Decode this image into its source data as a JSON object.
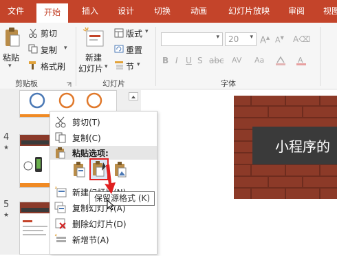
{
  "tabs": [
    {
      "label": "文件"
    },
    {
      "label": "开始"
    },
    {
      "label": "插入"
    },
    {
      "label": "设计"
    },
    {
      "label": "切换"
    },
    {
      "label": "动画"
    },
    {
      "label": "幻灯片放映"
    },
    {
      "label": "审阅"
    },
    {
      "label": "视图"
    }
  ],
  "ribbon": {
    "clipboard": {
      "paste": "粘贴",
      "cut": "剪切",
      "copy": "复制",
      "format_painter": "格式刷",
      "group_label": "剪贴板"
    },
    "slides": {
      "new_slide_line1": "新建",
      "new_slide_line2": "幻灯片",
      "layout": "版式",
      "reset": "重置",
      "section": "节",
      "group_label": "幻灯片"
    },
    "font": {
      "font_size": "20",
      "group_label": "字体"
    }
  },
  "slide_panel": {
    "slide4_num": "4",
    "slide5_num": "5",
    "star": "★"
  },
  "context_menu": {
    "cut": "剪切(T)",
    "copy": "复制(C)",
    "paste_options": "粘贴选项:",
    "new_slide": "新建幻灯片(N)",
    "duplicate": "复制幻灯片(A)",
    "delete": "删除幻灯片(D)",
    "new_section": "新增节(A)"
  },
  "tooltip": "保留源格式 (K)",
  "slide": {
    "title": "小程序的"
  },
  "colors": {
    "accent": "#c4442a",
    "highlight_box": "#e02020"
  }
}
